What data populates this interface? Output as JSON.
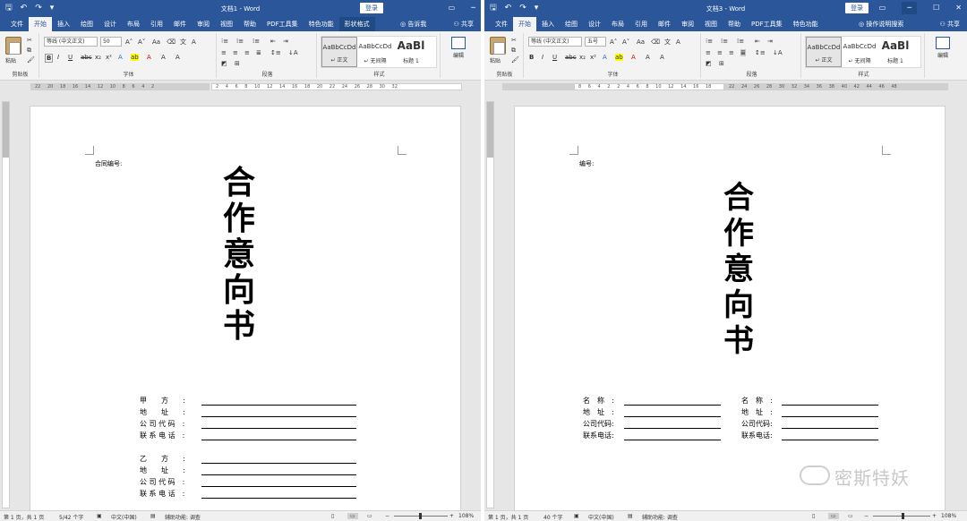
{
  "left": {
    "qat": {
      "save": "🖫",
      "undo": "↶",
      "redo": "↷",
      "more": "▾"
    },
    "title": "文档1 - Word",
    "login": "登录",
    "tabs": [
      "文件",
      "开始",
      "插入",
      "绘图",
      "设计",
      "布局",
      "引用",
      "邮件",
      "审阅",
      "视图",
      "帮助",
      "PDF工具集",
      "特色功能"
    ],
    "context_tab": "形状格式",
    "tell_me": "告诉我",
    "share": "共享",
    "font_name": "等线 (中文正文)",
    "font_size": "50",
    "groups": {
      "clipboard": "剪贴板",
      "font": "字体",
      "paragraph": "段落",
      "styles": "样式",
      "editing": "编辑"
    },
    "paste_label": "粘贴",
    "styles": [
      {
        "preview": "AaBbCcDd",
        "name": "↵ 正文"
      },
      {
        "preview": "AaBbCcDd",
        "name": "↵ 无间隔"
      },
      {
        "preview": "AaBl",
        "name": "标题 1"
      }
    ],
    "ruler_text": "22 20 18 16 14 12 10 8 6 4 2",
    "ruler_text2": "2 4 6 8 10 12 14 16 18 20 22 24 26 28 30 32",
    "contract_label": "合同编号:",
    "title_chars": [
      "合",
      "作",
      "意",
      "向",
      "书"
    ],
    "form_a": [
      "甲　　方　　:",
      "地　　址　　:",
      "公 司 代 码　:",
      "联 系 电 话　:"
    ],
    "form_b": [
      "乙　　方　　:",
      "地　　址　　:",
      "公 司 代 码　:",
      "联 系 电 话　:"
    ],
    "status": {
      "page": "第 1 页，共 1 页",
      "words": "5/42 个字",
      "lang": "中文(中国)",
      "access": "辅助功能: 调查",
      "zoom": "108%"
    }
  },
  "right": {
    "title": "文档3 - Word",
    "login": "登录",
    "tabs": [
      "文件",
      "开始",
      "插入",
      "绘图",
      "设计",
      "布局",
      "引用",
      "邮件",
      "审阅",
      "视图",
      "帮助",
      "PDF工具集",
      "特色功能"
    ],
    "tell_me": "操作说明搜索",
    "share": "共享",
    "font_name": "等线 (中文正文)",
    "font_size": "五号",
    "groups": {
      "clipboard": "剪贴板",
      "font": "字体",
      "paragraph": "段落",
      "styles": "样式",
      "editing": "编辑"
    },
    "paste_label": "粘贴",
    "styles": [
      {
        "preview": "AaBbCcDd",
        "name": "↵ 正文"
      },
      {
        "preview": "AaBbCcDd",
        "name": "↵ 无间隔"
      },
      {
        "preview": "AaBl",
        "name": "标题 1"
      }
    ],
    "ruler_text": "8 6 4 2 2 4 6 8 10 12 14 16 18",
    "ruler_text2": "22 24 26 28 30 32 34 36 38 40 42 44 46 48",
    "contract_label": "编号:",
    "title_chars": [
      "合",
      "作",
      "意",
      "向",
      "书"
    ],
    "form_left": [
      "名　称　:",
      "地　址　:",
      "公司代码:",
      "联系电话:"
    ],
    "form_right": [
      "名　称　:",
      "地　址　:",
      "公司代码:",
      "联系电话:"
    ],
    "status": {
      "page": "第 1 页，共 1 页",
      "words": "40 个字",
      "lang": "中文(中国)",
      "access": "辅助功能: 调查",
      "zoom": "108%"
    }
  },
  "watermark": "密斯特妖"
}
